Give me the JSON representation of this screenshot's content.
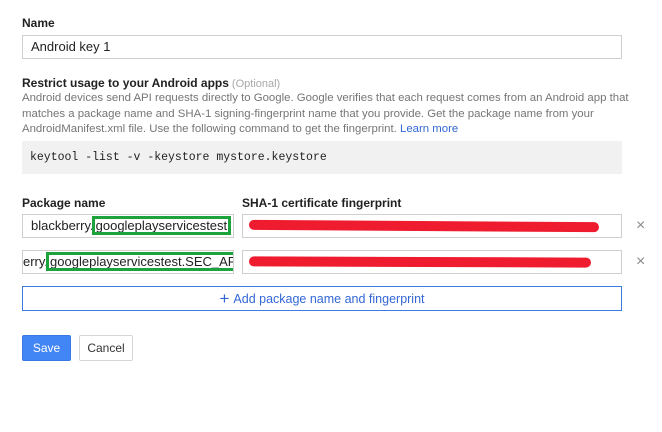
{
  "name_section": {
    "label": "Name",
    "value": "Android key 1"
  },
  "restrict": {
    "title": "Restrict usage to your Android apps",
    "optional": "(Optional)",
    "desc_line1": "Android devices send API requests directly to Google. Google verifies that each request comes from an Android app that",
    "desc_line2": "matches a package name and SHA-1 signing-fingerprint name that you provide. Get the package name from your",
    "desc_line3": "AndroidManifest.xml file. Use the following command to get the fingerprint.",
    "learn_more": "Learn more",
    "command": "keytool -list -v -keystore mystore.keystore"
  },
  "table": {
    "package_header": "Package name",
    "sha_header": "SHA-1 certificate fingerprint",
    "rows": [
      {
        "pkg_prefix": "blackberry.",
        "pkg_highlight": "googleplayservicestest"
      },
      {
        "pkg_prefix": "erry.",
        "pkg_highlight": "googleplayservicestest.SEC_APP"
      }
    ],
    "remove_glyph": "×"
  },
  "add_button": {
    "icon": "+",
    "label": "Add package name and fingerprint"
  },
  "actions": {
    "save": "Save",
    "cancel": "Cancel"
  },
  "colors": {
    "primary": "#4285f4",
    "link": "#3367d6",
    "highlight_box": "#1da33c",
    "redaction": "#ee1c2e"
  }
}
